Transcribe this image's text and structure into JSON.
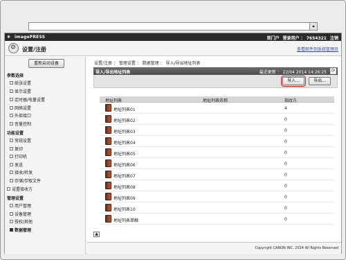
{
  "browser": {
    "url": ""
  },
  "topbar": {
    "brand": "imagePRESS",
    "links": [
      "到门户",
      "登录用户 ： 7654321",
      "注销"
    ]
  },
  "header": {
    "title": "设置/注册",
    "link": "查看邮件到系统管理员"
  },
  "sidebar": {
    "restart_label": "重新启动设备",
    "groups": [
      {
        "label": "参数选择",
        "items": [
          "纸张设置",
          "显示设置",
          "定时器/电量设置",
          "网络设置",
          "外部接口",
          "音量控制"
        ]
      },
      {
        "label": "功能设置",
        "items": [
          "常规设置",
          "复印",
          "打印机",
          "发送",
          "接收/转发",
          "存储/存取文件"
        ]
      },
      {
        "label": "设置接收方",
        "items": []
      },
      {
        "label": "管理设置",
        "items": [
          "用户管理",
          "设备管理",
          "授权/其他",
          "数据管理"
        ]
      }
    ]
  },
  "breadcrumb": "设置/注册 ： 管理设置 ： 数据管理 ： 导入/导出地址列表",
  "panel": {
    "title": "导入/导出地址列表",
    "updated": "最近更新 ： 22/04 2014 14:26:25",
    "import_label": "导入...",
    "export_label": "导出..."
  },
  "table": {
    "headers": [
      "地址列表",
      "地址列表名称",
      "指纹方"
    ],
    "rows": [
      {
        "name": "地址列表01",
        "count": "4"
      },
      {
        "name": "地址列表02",
        "count": "0"
      },
      {
        "name": "地址列表03",
        "count": "0"
      },
      {
        "name": "地址列表04",
        "count": "0"
      },
      {
        "name": "地址列表05",
        "count": "0"
      },
      {
        "name": "地址列表06",
        "count": "0"
      },
      {
        "name": "地址列表07",
        "count": "0"
      },
      {
        "name": "地址列表08",
        "count": "0"
      },
      {
        "name": "地址列表09",
        "count": "0"
      },
      {
        "name": "地址列表10",
        "count": "0"
      },
      {
        "name": "地址列表单触",
        "count": "0"
      }
    ]
  },
  "footer": {
    "copyright": "Copyright CANON INC. 2014 All Rights Reserved"
  },
  "icons": {
    "home": "settings-gear-icon",
    "book": "address-book-icon",
    "refresh": "refresh-icon"
  }
}
